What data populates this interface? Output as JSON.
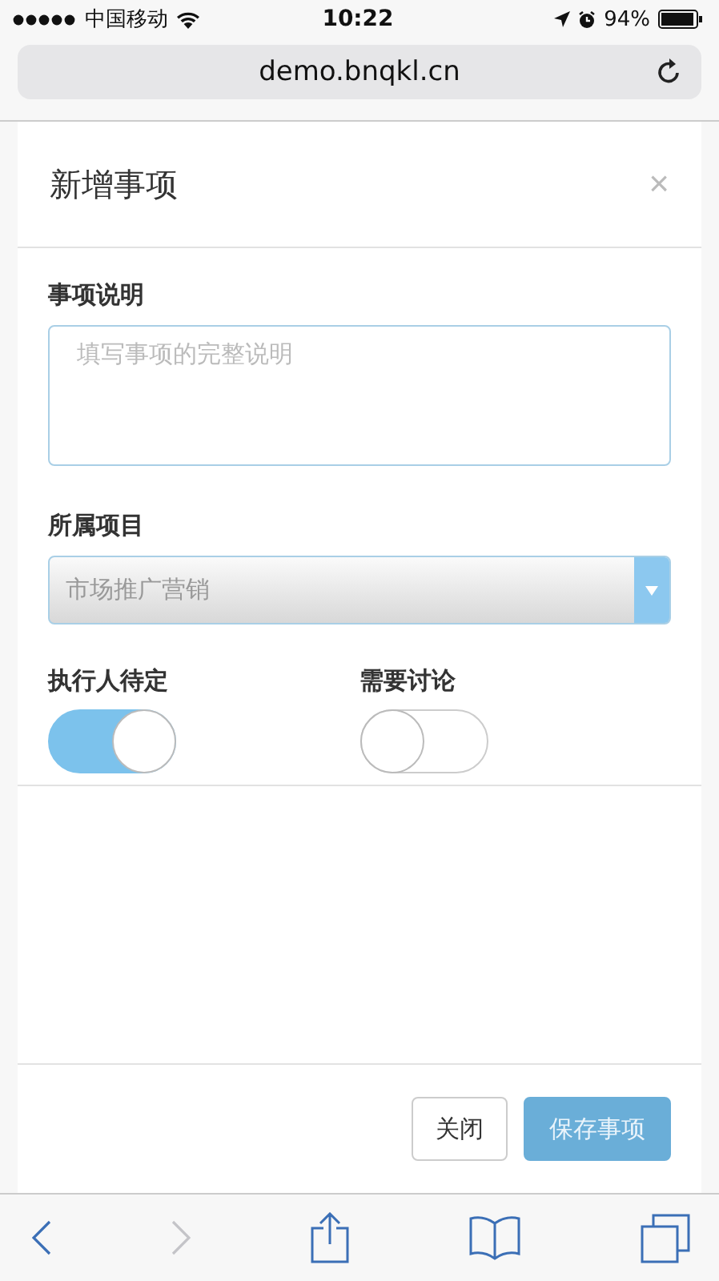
{
  "status_bar": {
    "carrier": "中国移动",
    "time": "10:22",
    "battery": "94%"
  },
  "address_bar": {
    "url": "demo.bnqkl.cn"
  },
  "dialog": {
    "title": "新增事项",
    "close": "×",
    "fields": [
      {
        "kind": "textarea",
        "label": "事项说明",
        "placeholder": "填写事项的完整说明"
      },
      {
        "kind": "select",
        "label": "所属项目",
        "value": "市场推广营销"
      }
    ],
    "toggles": [
      {
        "label": "执行人待定",
        "on": true
      },
      {
        "label": "需要讨论",
        "on": false
      }
    ],
    "buttons": [
      {
        "label": "关闭",
        "kind": "secondary"
      },
      {
        "label": "保存事项",
        "kind": "primary"
      }
    ]
  },
  "toolbar": {
    "back_disabled": false,
    "forward_disabled": true
  }
}
